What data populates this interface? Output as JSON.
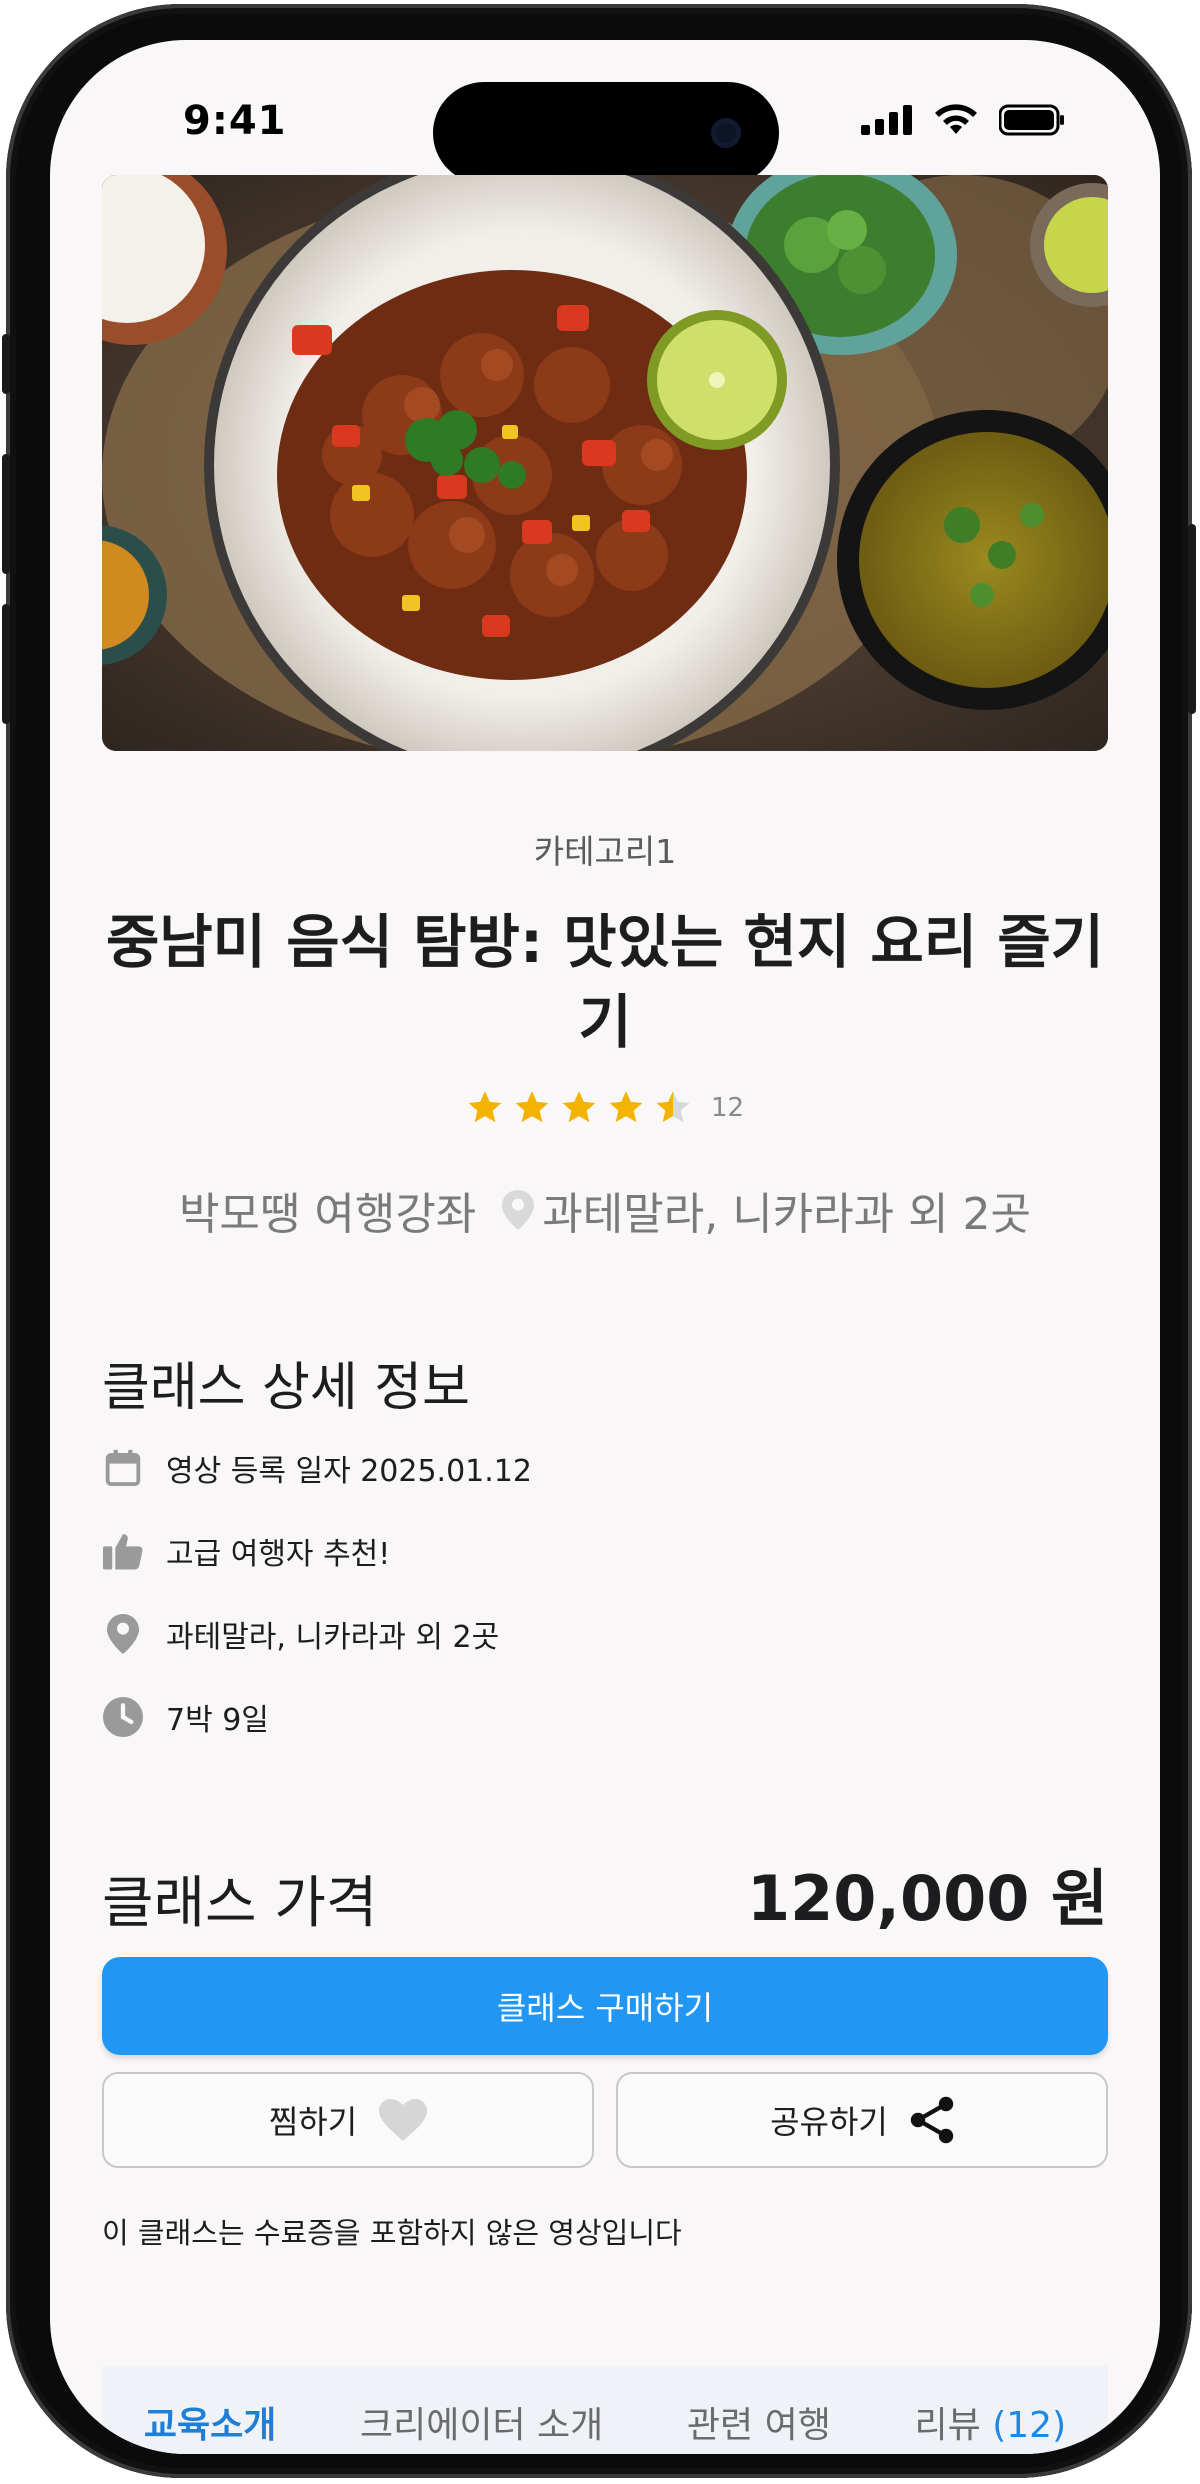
{
  "status_bar": {
    "time": "9:41"
  },
  "course": {
    "category": "카테고리1",
    "title": "중남미 음식 탐방: 맛있는 현지 요리 즐기기",
    "rating": 4.5,
    "review_count": "12",
    "creator": "박모땡 여행강좌",
    "location": "과테말라, 니카라과 외 2곳"
  },
  "details": {
    "section_title": "클래스 상세 정보",
    "items": [
      {
        "icon": "calendar-icon",
        "text": "영상 등록 일자 2025.01.12"
      },
      {
        "icon": "thumbs-up-icon",
        "text": "고급 여행자 추천!"
      },
      {
        "icon": "location-pin-icon",
        "text": "과테말라, 니카라과 외 2곳"
      },
      {
        "icon": "clock-icon",
        "text": "7박 9일"
      }
    ]
  },
  "price": {
    "label": "클래스 가격",
    "value": "120,000 원"
  },
  "actions": {
    "buy_label": "클래스 구매하기",
    "wishlist_label": "찜하기",
    "share_label": "공유하기"
  },
  "notice": "이 클래스는 수료증을 포함하지 않은 영상입니다",
  "tabs": {
    "intro": "교육소개",
    "creator": "크리에이터 소개",
    "related": "관련 여행",
    "review": "리뷰",
    "review_count": "(12)"
  },
  "colors": {
    "primary": "#2196f3",
    "star": "#f5b301",
    "tab_active": "#1e7fd6",
    "screen_bg": "#f9f7f8"
  }
}
